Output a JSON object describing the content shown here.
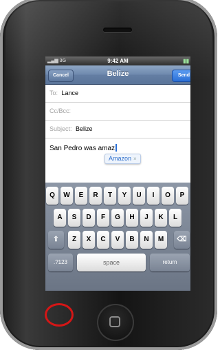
{
  "status": {
    "time": "9:42 AM",
    "carrier_icon": "signal-bars-3g",
    "battery_icon": "battery"
  },
  "nav": {
    "cancel": "Cancel",
    "title": "Belize",
    "send": "Send"
  },
  "fields": {
    "to_label": "To:",
    "to_value": "Lance",
    "ccbcc_label": "Cc/Bcc:",
    "subject_label": "Subject:",
    "subject_value": "Belize"
  },
  "body": {
    "text": "San Pedro was amaz"
  },
  "autocorrect": {
    "suggestion": "Amazon",
    "dismiss": "×"
  },
  "keyboard": {
    "row1": [
      "Q",
      "W",
      "E",
      "R",
      "T",
      "Y",
      "U",
      "I",
      "O",
      "P"
    ],
    "row2": [
      "A",
      "S",
      "D",
      "F",
      "G",
      "H",
      "J",
      "K",
      "L"
    ],
    "row3": [
      "Z",
      "X",
      "C",
      "V",
      "B",
      "N",
      "M"
    ],
    "shift_icon": "⇧",
    "delete_icon": "⌫",
    "numbers_label": ".?123",
    "space_label": "space",
    "return_label": "return"
  },
  "colors": {
    "highlight": "#d41616",
    "send": "#2a6fd6",
    "nav": "#6d88ad"
  }
}
